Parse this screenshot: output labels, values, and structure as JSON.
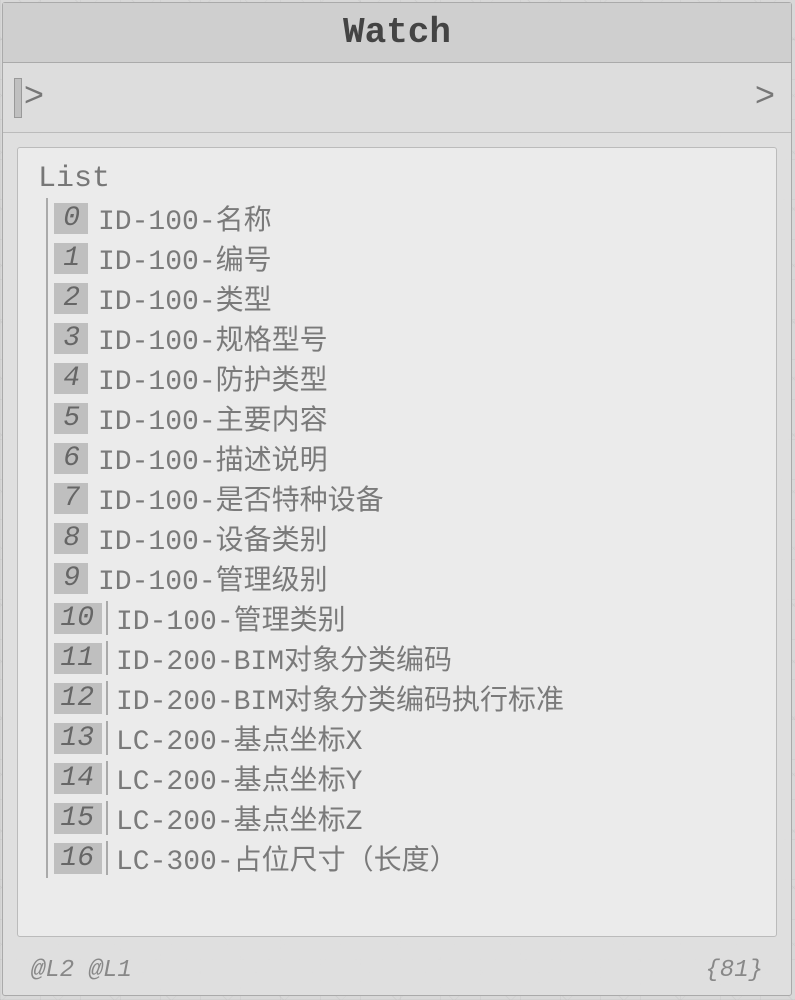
{
  "title": "Watch",
  "ports": {
    "input_glyph": ">",
    "output_glyph": ">"
  },
  "list": {
    "label": "List",
    "items": [
      {
        "idx": "0",
        "val": "ID-100-名称"
      },
      {
        "idx": "1",
        "val": "ID-100-编号"
      },
      {
        "idx": "2",
        "val": "ID-100-类型"
      },
      {
        "idx": "3",
        "val": "ID-100-规格型号"
      },
      {
        "idx": "4",
        "val": "ID-100-防护类型"
      },
      {
        "idx": "5",
        "val": "ID-100-主要内容"
      },
      {
        "idx": "6",
        "val": "ID-100-描述说明"
      },
      {
        "idx": "7",
        "val": "ID-100-是否特种设备"
      },
      {
        "idx": "8",
        "val": "ID-100-设备类别"
      },
      {
        "idx": "9",
        "val": "ID-100-管理级别"
      },
      {
        "idx": "10",
        "val": "ID-100-管理类别"
      },
      {
        "idx": "11",
        "val": "ID-200-BIM对象分类编码"
      },
      {
        "idx": "12",
        "val": "ID-200-BIM对象分类编码执行标准"
      },
      {
        "idx": "13",
        "val": "LC-200-基点坐标X"
      },
      {
        "idx": "14",
        "val": "LC-200-基点坐标Y"
      },
      {
        "idx": "15",
        "val": "LC-200-基点坐标Z"
      },
      {
        "idx": "16",
        "val": "LC-300-占位尺寸（长度）"
      }
    ]
  },
  "footer": {
    "levels": "@L2 @L1",
    "count": "{81}"
  }
}
